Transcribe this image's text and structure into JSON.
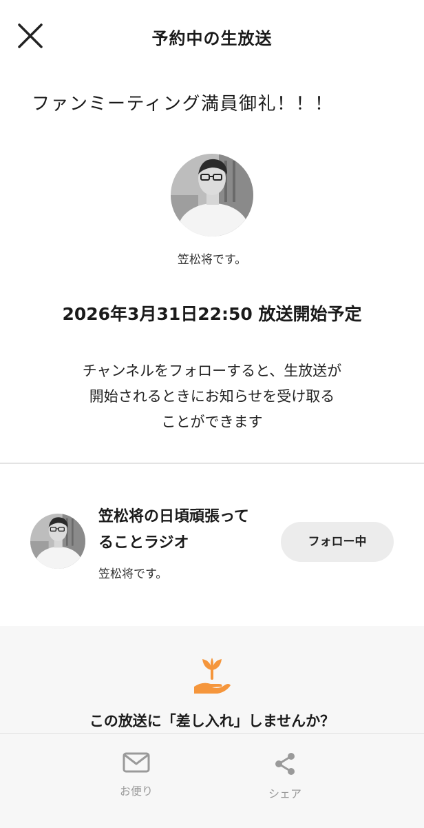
{
  "header": {
    "title": "予約中の生放送",
    "close_icon": "close-icon"
  },
  "broadcast": {
    "title": "ファンミーティング満員御礼！！！",
    "host_name": "笠松将です。",
    "schedule": "2026年3月31日22:50 放送開始予定",
    "notice_lines": [
      "チャンネルをフォローすると、生放送が",
      "開始されるときにお知らせを受け取る",
      "ことができます"
    ]
  },
  "channel": {
    "name_line1": "笠松将の日頃頑張って",
    "name_line2": "ることラジオ",
    "owner": "笠松将です。",
    "follow_label": "フォロー中"
  },
  "gift": {
    "icon": "sprout-hand-icon",
    "text": "この放送に「差し入れ」しませんか？",
    "accent_color": "#f5963c"
  },
  "bottom_bar": {
    "tabs": [
      {
        "label": "お便り",
        "icon": "mail-icon"
      },
      {
        "label": "シェア",
        "icon": "share-icon"
      }
    ]
  }
}
